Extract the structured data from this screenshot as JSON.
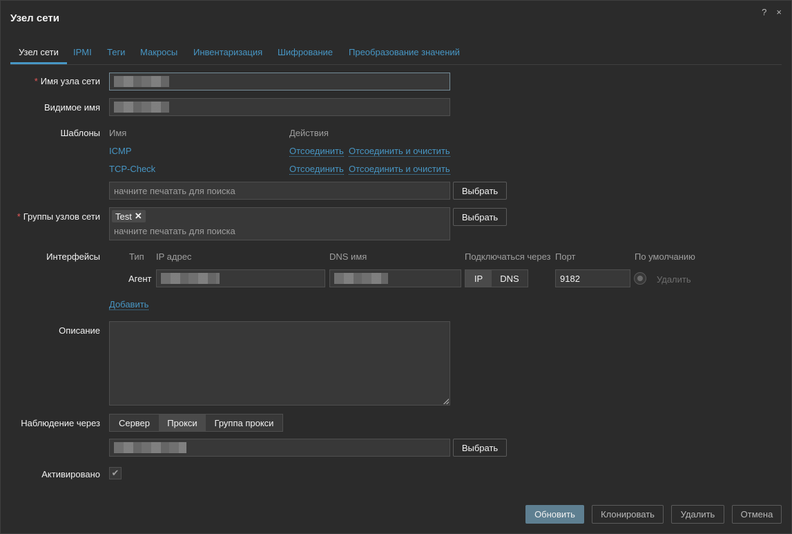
{
  "dialog": {
    "title": "Узел сети",
    "help_icon": "?",
    "close_icon": "×"
  },
  "tabs": [
    {
      "label": "Узел сети",
      "active": true
    },
    {
      "label": "IPMI"
    },
    {
      "label": "Теги"
    },
    {
      "label": "Макросы"
    },
    {
      "label": "Инвентаризация"
    },
    {
      "label": "Шифрование"
    },
    {
      "label": "Преобразование значений"
    }
  ],
  "host_name": {
    "label": "Имя узла сети",
    "required_mark": "*"
  },
  "visible_name": {
    "label": "Видимое имя"
  },
  "templates": {
    "label": "Шаблоны",
    "col_name": "Имя",
    "col_actions": "Действия",
    "rows": [
      {
        "name": "ICMP",
        "unlink": "Отсоединить",
        "unlink_clear": "Отсоединить и очистить"
      },
      {
        "name": "TCP-Check",
        "unlink": "Отсоединить",
        "unlink_clear": "Отсоединить и очистить"
      }
    ],
    "search_placeholder": "начните печатать для поиска",
    "select_label": "Выбрать"
  },
  "host_groups": {
    "label": "Группы узлов сети",
    "required_mark": "*",
    "tag": "Test",
    "tag_remove": "✕",
    "search_placeholder": "начните печатать для поиска",
    "select_label": "Выбрать"
  },
  "interfaces": {
    "label": "Интерфейсы",
    "col_type": "Тип",
    "col_ip": "IP адрес",
    "col_dns": "DNS имя",
    "col_connect": "Подключаться через",
    "col_port": "Порт",
    "col_default": "По умолчанию",
    "row": {
      "type": "Агент",
      "connect_ip": "IP",
      "connect_dns": "DNS",
      "port": "9182",
      "remove": "Удалить"
    },
    "add": "Добавить"
  },
  "description": {
    "label": "Описание"
  },
  "monitored_by": {
    "label": "Наблюдение через",
    "options": [
      "Сервер",
      "Прокси",
      "Группа прокси"
    ],
    "selected": "Прокси",
    "select_label": "Выбрать"
  },
  "enabled": {
    "label": "Активировано",
    "checked": true,
    "check": "✔"
  },
  "footer": {
    "update": "Обновить",
    "clone": "Клонировать",
    "delete": "Удалить",
    "cancel": "Отмена"
  }
}
